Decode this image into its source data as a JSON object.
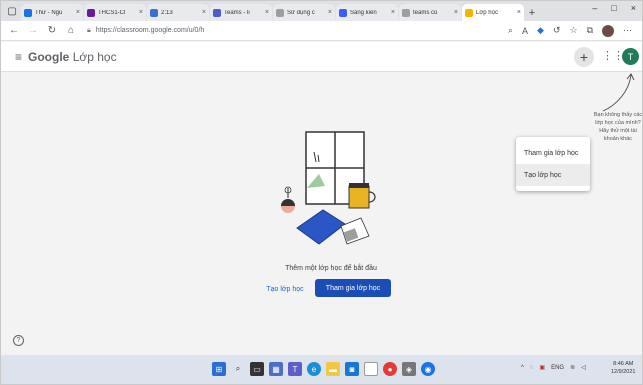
{
  "browser": {
    "tabs": [
      {
        "title": "Thư - Ngu",
        "color": "#1a73e8",
        "active": false
      },
      {
        "title": "THCS1-Cl",
        "color": "#6a1b9a",
        "active": false
      },
      {
        "title": "2:13",
        "color": "#3b6fd8",
        "active": false
      },
      {
        "title": "Teams - li",
        "color": "#4a5dc9",
        "active": false
      },
      {
        "title": "Sử dụng c",
        "color": "#9e9e9e",
        "active": false
      },
      {
        "title": "Sáng kiến",
        "color": "#3d5afe",
        "active": false
      },
      {
        "title": "teams củ",
        "color": "#9e9e9e",
        "active": false
      },
      {
        "title": "Lớp học",
        "color": "#f4b400",
        "active": true
      }
    ],
    "new_tab": "+",
    "window_controls": {
      "minimize": "–",
      "maximize": "□",
      "close": "×"
    },
    "url": "https://classroom.google.com/u/0/h"
  },
  "app": {
    "logo_google": "Google",
    "logo_product": "Lớp học",
    "plus_label": "+",
    "avatar_letter": "T",
    "menu": {
      "join": "Tham gia lớp học",
      "create": "Tạo lớp học"
    },
    "hint": "Bạn không thấy các lớp học của mình? Hãy thử một tài khoản khác",
    "empty_text": "Thêm một lớp học để bắt đầu",
    "create_button": "Tạo lớp học",
    "join_button": "Tham gia lớp học",
    "help": "?"
  },
  "system": {
    "tray": {
      "lang": "ENG"
    },
    "time": "8:46 AM",
    "date": "12/9/2021"
  }
}
